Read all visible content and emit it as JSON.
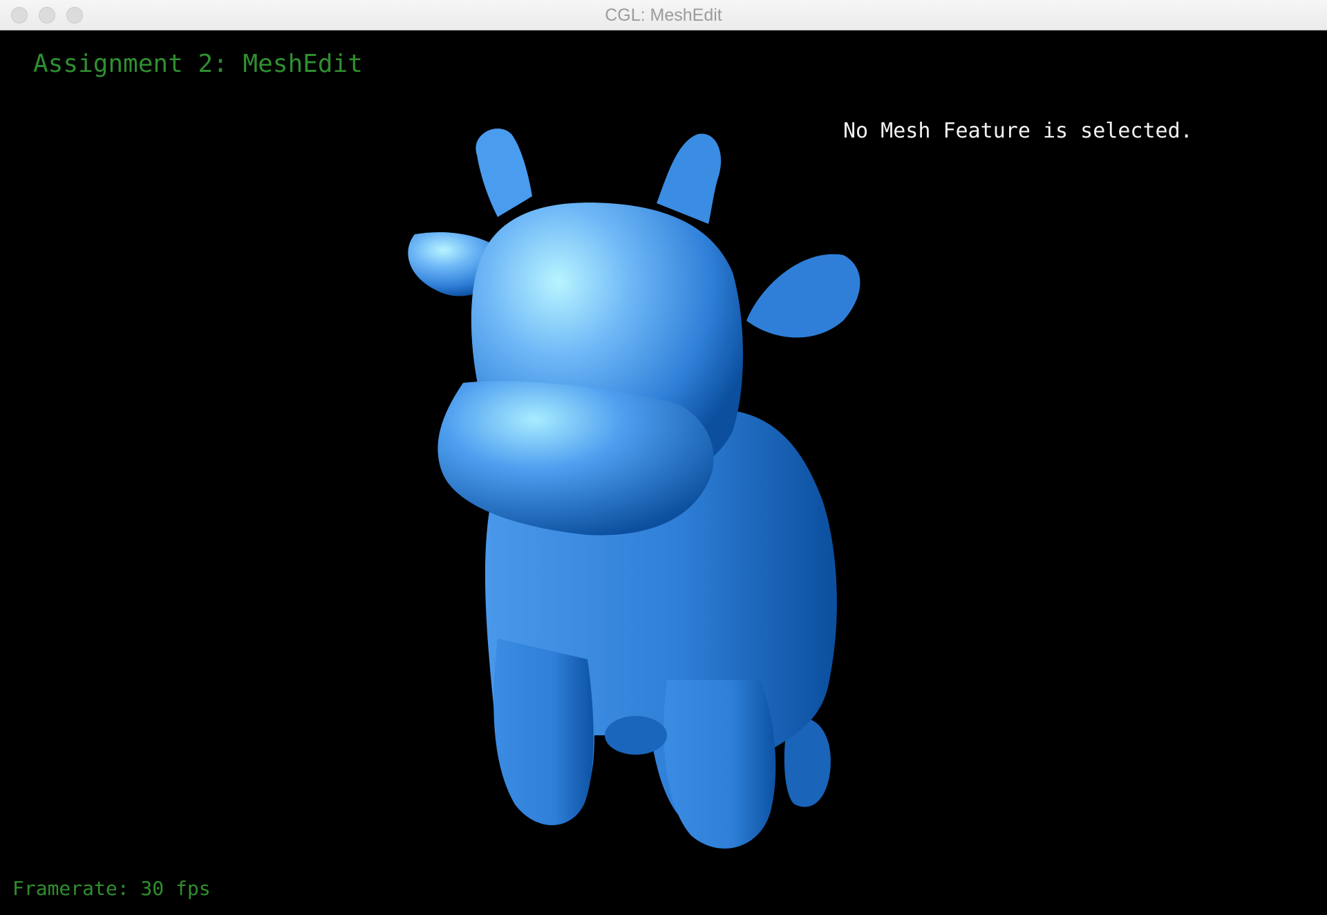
{
  "window": {
    "title": "CGL: MeshEdit"
  },
  "hud": {
    "assignment_title": "Assignment 2: MeshEdit",
    "selection_status": "No Mesh Feature is selected.",
    "framerate": "Framerate: 30 fps"
  },
  "colors": {
    "background": "#000000",
    "hud_green": "#2f8f2f",
    "mesh_blue": "#2f7fd8",
    "mesh_highlight": "#b8f4ff",
    "mesh_shadow": "#0b4f9e"
  },
  "icons": {
    "close": "window-close-icon",
    "minimize": "window-minimize-icon",
    "maximize": "window-maximize-icon"
  }
}
